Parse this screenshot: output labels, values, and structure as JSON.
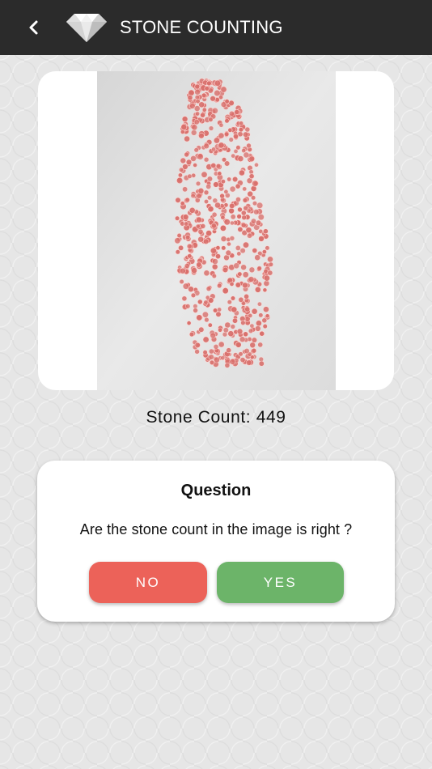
{
  "app_bar": {
    "title": "STONE COUNTING",
    "back_icon": "chevron-left-icon",
    "logo_icon": "diamond-icon"
  },
  "result": {
    "label": "Stone Count:",
    "value": "449"
  },
  "question": {
    "title": "Question",
    "text": "Are the stone count in the image is right ?",
    "no_label": "NO",
    "yes_label": "YES"
  },
  "colors": {
    "app_bar": "#2b2b2b",
    "no_button": "#ec6259",
    "yes_button": "#6cb469",
    "stones": "#d9706c"
  }
}
